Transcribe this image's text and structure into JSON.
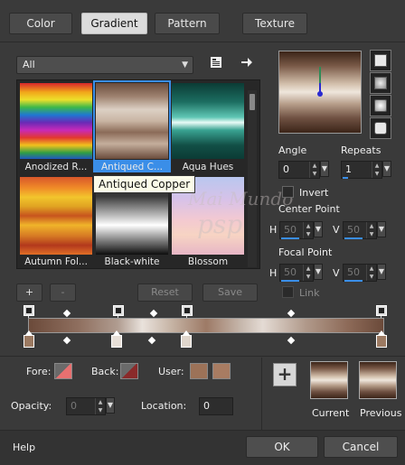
{
  "tabs": [
    {
      "label": "Color"
    },
    {
      "label": "Gradient"
    },
    {
      "label": "Pattern"
    },
    {
      "label": "Texture"
    }
  ],
  "library": {
    "category": "All",
    "items": [
      {
        "label": "Anodized R..."
      },
      {
        "label": "Antiqued C..."
      },
      {
        "label": "Aqua Hues"
      },
      {
        "label": "Autumn Fol..."
      },
      {
        "label": "Black-white"
      },
      {
        "label": "Blossom"
      }
    ],
    "tooltip": "Antiqued Copper",
    "watermark_line1": "Mai Mundo",
    "watermark_line2": "psp"
  },
  "stop_buttons": {
    "add": "+",
    "remove": "-",
    "reset": "Reset",
    "save": "Save"
  },
  "settings": {
    "angle_label": "Angle",
    "angle_value": "0",
    "repeats_label": "Repeats",
    "repeats_value": "1",
    "invert_label": "Invert",
    "center_point_label": "Center Point",
    "focal_point_label": "Focal Point",
    "h_label": "H",
    "v_label": "V",
    "center_h": "50",
    "center_v": "50",
    "focal_h": "50",
    "focal_v": "50",
    "link_label": "Link"
  },
  "stop_editor": {
    "fore_label": "Fore:",
    "back_label": "Back:",
    "user_label": "User:",
    "user_color": "#9c7258",
    "user_color2": "#a87c62",
    "opacity_label": "Opacity:",
    "opacity_value": "0",
    "location_label": "Location:",
    "location_value": "0"
  },
  "swatches": {
    "current_label": "Current",
    "previous_label": "Previous",
    "add": "+"
  },
  "footer": {
    "help": "Help",
    "ok": "OK",
    "cancel": "Cancel"
  }
}
